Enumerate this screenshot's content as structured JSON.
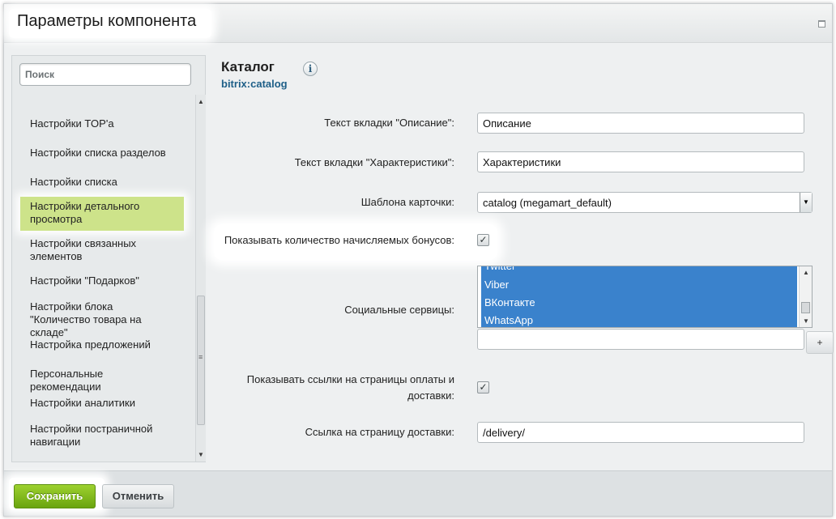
{
  "dialog": {
    "title": "Параметры компонента"
  },
  "sidebar": {
    "search_placeholder": "Поиск",
    "items": [
      {
        "label": "Настройки TOP'a"
      },
      {
        "label": "Настройки списка разделов"
      },
      {
        "label": "Настройки списка"
      },
      {
        "label": "Настройки детального просмотра",
        "active": true
      },
      {
        "label": "Настройки связанных элементов"
      },
      {
        "label": "Настройки \"Подарков\""
      },
      {
        "label": "Настройки блока \"Количество товара на складе\""
      },
      {
        "label": "Настройка предложений"
      },
      {
        "label": "Персональные рекомендации"
      },
      {
        "label": "Настройки аналитики"
      },
      {
        "label": "Настройки постраничной навигации"
      }
    ]
  },
  "component": {
    "title": "Каталог",
    "code": "bitrix:catalog",
    "info_icon": "i"
  },
  "form": {
    "description_tab_label": "Текст вкладки \"Описание\":",
    "description_tab_value": "Описание",
    "features_tab_label": "Текст вкладки \"Характеристики\":",
    "features_tab_value": "Характеристики",
    "card_template_label": "Шаблона карточки:",
    "card_template_value": "catalog (megamart_default)",
    "show_bonus_label": "Показывать количество начисляемых бонусов:",
    "show_bonus_checked": true,
    "social_label": "Социальные сервицы:",
    "social_options": [
      "Twitter",
      "Viber",
      "ВКонтакте",
      "WhatsApp"
    ],
    "social_add_button": "+",
    "show_links_label": "Показывать ссылки на страницы оплаты и доставки:",
    "show_links_checked": true,
    "delivery_page_label": "Ссылка на страницу доставки:",
    "delivery_page_value": "/delivery/"
  },
  "footer": {
    "save_label": "Сохранить",
    "cancel_label": "Отменить"
  },
  "colors": {
    "accent_green": "#7bb41c",
    "selection_blue": "#3a82cc",
    "active_item": "#cde38a",
    "link_blue": "#1e5f88"
  }
}
